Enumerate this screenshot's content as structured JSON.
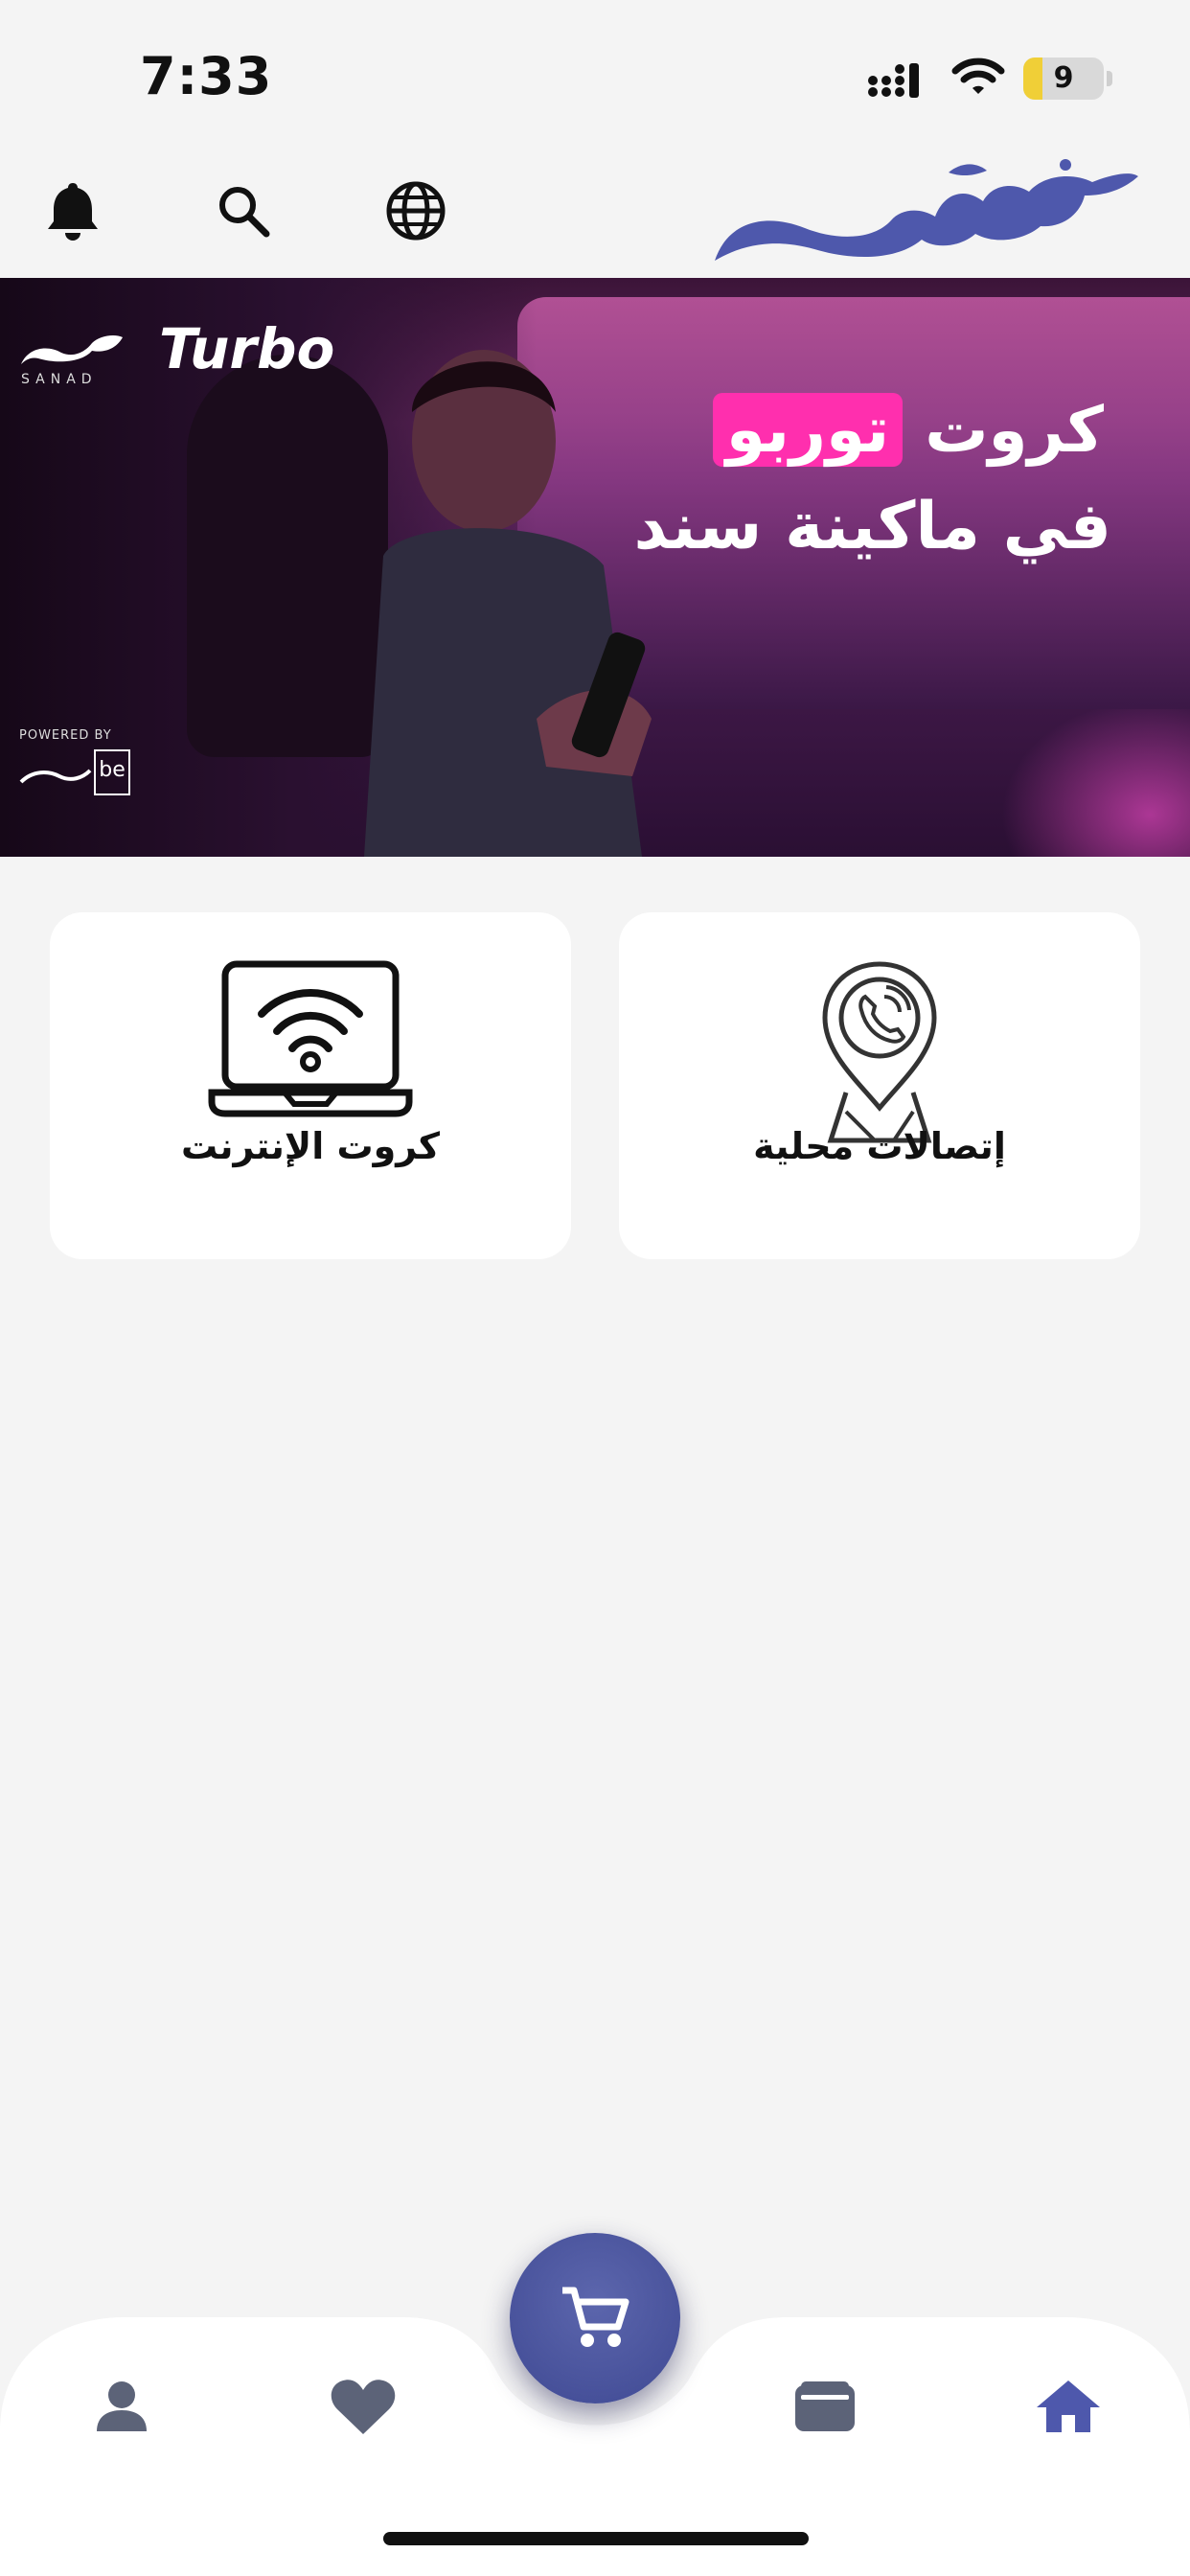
{
  "status_bar": {
    "time": "7:33",
    "battery_level": "9",
    "battery_fraction": 0.09
  },
  "header": {
    "icons": [
      "bell-icon",
      "search-icon",
      "globe-icon"
    ],
    "brand_color": "#4e58ac"
  },
  "banner": {
    "line1_prefix": "كروت",
    "line1_highlight": "توربو",
    "line2": "في ماكينة سند",
    "turbo_label": "Turbo",
    "sanad_label": "SANAD",
    "powered_by": "POWERED BY",
    "partner_box": "be"
  },
  "services": [
    {
      "label": "إتصالات محلية",
      "icon": "location-phone-icon"
    },
    {
      "label": "كروت الإنترنت",
      "icon": "laptop-wifi-icon"
    }
  ],
  "bottom_nav": {
    "items": [
      "profile-icon",
      "heart-icon",
      "cart-icon",
      "wallet-icon",
      "home-icon"
    ],
    "active": "home-icon",
    "active_color": "#4e58ac",
    "inactive_color": "#5c6378"
  }
}
